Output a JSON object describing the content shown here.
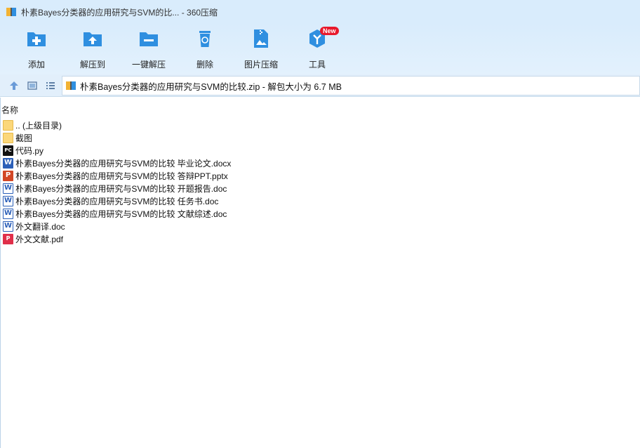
{
  "window": {
    "title": "朴素Bayes分类器的应用研究与SVM的比...  - 360压缩",
    "app_icon": "archive-icon"
  },
  "toolbar": {
    "items": [
      {
        "label": "添加",
        "icon": "add-folder-icon"
      },
      {
        "label": "解压到",
        "icon": "extract-to-icon"
      },
      {
        "label": "一键解压",
        "icon": "one-click-extract-icon"
      },
      {
        "label": "删除",
        "icon": "recycle-bin-icon"
      },
      {
        "label": "图片压缩",
        "icon": "image-compress-icon"
      },
      {
        "label": "工具",
        "icon": "tools-icon",
        "badge": "New"
      }
    ]
  },
  "address_bar": {
    "path": "朴素Bayes分类器的应用研究与SVM的比较.zip - 解包大小为 6.7 MB"
  },
  "file_list": {
    "column_name": "名称",
    "items": [
      {
        "name": ".. (上级目录)",
        "type": "folder"
      },
      {
        "name": "截图",
        "type": "folder"
      },
      {
        "name": "代码.py",
        "type": "py"
      },
      {
        "name": "朴素Bayes分类器的应用研究与SVM的比较 毕业论文.docx",
        "type": "docx"
      },
      {
        "name": "朴素Bayes分类器的应用研究与SVM的比较 答辩PPT.pptx",
        "type": "pptx"
      },
      {
        "name": "朴素Bayes分类器的应用研究与SVM的比较 开题报告.doc",
        "type": "doc"
      },
      {
        "name": "朴素Bayes分类器的应用研究与SVM的比较 任务书.doc",
        "type": "doc"
      },
      {
        "name": "朴素Bayes分类器的应用研究与SVM的比较 文献综述.doc",
        "type": "doc"
      },
      {
        "name": "外文翻译.doc",
        "type": "doc"
      },
      {
        "name": "外文文献.pdf",
        "type": "pdf"
      }
    ]
  },
  "colors": {
    "toolbar_bg": "#d9ecfc",
    "icon_blue": "#2f8fe0",
    "badge_red": "#e8192c"
  }
}
